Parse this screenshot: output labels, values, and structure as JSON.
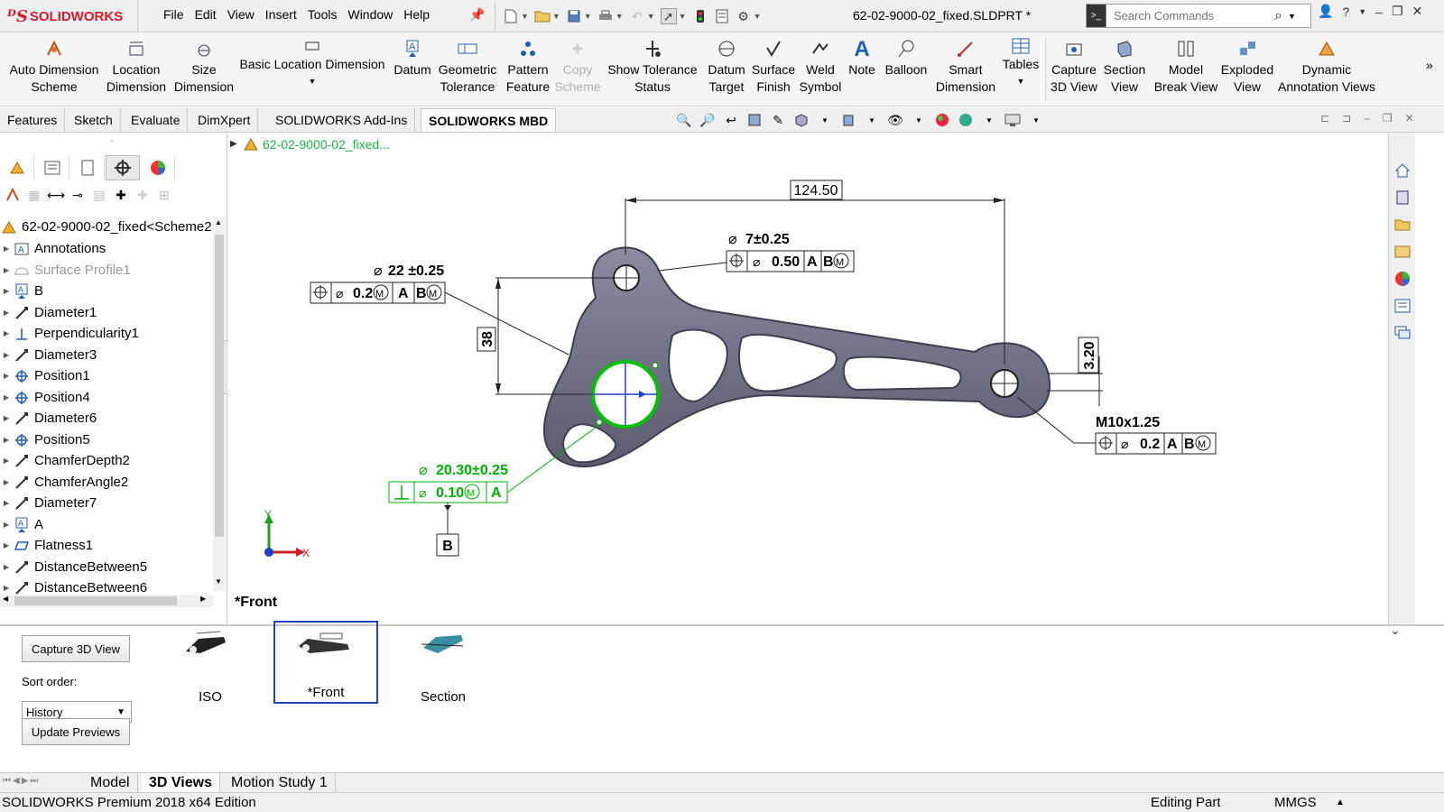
{
  "app": {
    "brand": "SOLIDWORKS",
    "menu": [
      "File",
      "Edit",
      "View",
      "Insert",
      "Tools",
      "Window",
      "Help"
    ],
    "doc_title": "62-02-9000-02_fixed.SLDPRT *",
    "search_placeholder": "Search Commands"
  },
  "ribbon": {
    "auto_dim_1": "Auto Dimension",
    "auto_dim_2": "Scheme",
    "loc_dim_1": "Location",
    "loc_dim_2": "Dimension",
    "size_dim_1": "Size",
    "size_dim_2": "Dimension",
    "basic_loc": "Basic Location Dimension",
    "datum": "Datum",
    "geo_tol_1": "Geometric",
    "geo_tol_2": "Tolerance",
    "pattern_1": "Pattern",
    "pattern_2": "Feature",
    "copy_1": "Copy",
    "copy_2": "Scheme",
    "show_tol_1": "Show Tolerance",
    "show_tol_2": "Status",
    "datum_target_1": "Datum",
    "datum_target_2": "Target",
    "surface_1": "Surface",
    "surface_2": "Finish",
    "weld_1": "Weld",
    "weld_2": "Symbol",
    "note": "Note",
    "balloon": "Balloon",
    "smart_1": "Smart",
    "smart_2": "Dimension",
    "tables": "Tables",
    "capture_1": "Capture",
    "capture_2": "3D View",
    "section_1": "Section",
    "section_2": "View",
    "model_break_1": "Model",
    "model_break_2": "Break View",
    "exploded_1": "Exploded",
    "exploded_2": "View",
    "dynamic_1": "Dynamic",
    "dynamic_2": "Annotation Views"
  },
  "tabs": [
    "Features",
    "Sketch",
    "Evaluate",
    "DimXpert",
    "SOLIDWORKS Add-Ins",
    "SOLIDWORKS MBD"
  ],
  "tree": {
    "root": "62-02-9000-02_fixed<Scheme2",
    "items": [
      "Annotations",
      "Surface Profile1",
      "B",
      "Diameter1",
      "Perpendicularity1",
      "Diameter3",
      "Position1",
      "Position4",
      "Diameter6",
      "Position5",
      "ChamferDepth2",
      "ChamferAngle2",
      "Diameter7",
      "A",
      "Flatness1",
      "DistanceBetween5",
      "DistanceBetween6"
    ]
  },
  "graphics": {
    "breadcrumb": "62-02-9000-02_fixed...",
    "view_label": "*Front",
    "dim_124": "124.50",
    "dia7": "7±0.25",
    "fcf1_tol": "0.50",
    "fcf1_a": "A",
    "fcf1_b": "B",
    "dia22": "22 ±0.25",
    "fcf2_tol": "0.2",
    "fcf2_a": "A",
    "fcf2_b": "B",
    "dim38": "38",
    "dim320": "3.20",
    "thread": "M10x1.25",
    "fcf3_tol": "0.2",
    "fcf3_a": "A",
    "fcf3_b": "B",
    "dia2030": "20.30±0.25",
    "fcf4_tol": "0.10",
    "fcf4_a": "A",
    "datum_b": "B",
    "axis_x": "X",
    "axis_y": "Y",
    "accent": "#00c000"
  },
  "bottom": {
    "capture_btn": "Capture 3D View",
    "sort_label": "Sort order:",
    "sort_value": "History",
    "update_btn": "Update Previews",
    "views": [
      "ISO",
      "*Front",
      "Section"
    ]
  },
  "bottom_tabs": [
    "Model",
    "3D Views",
    "Motion Study 1"
  ],
  "status": {
    "edition": "SOLIDWORKS Premium 2018 x64 Edition",
    "mode": "Editing Part",
    "units": "MMGS"
  }
}
